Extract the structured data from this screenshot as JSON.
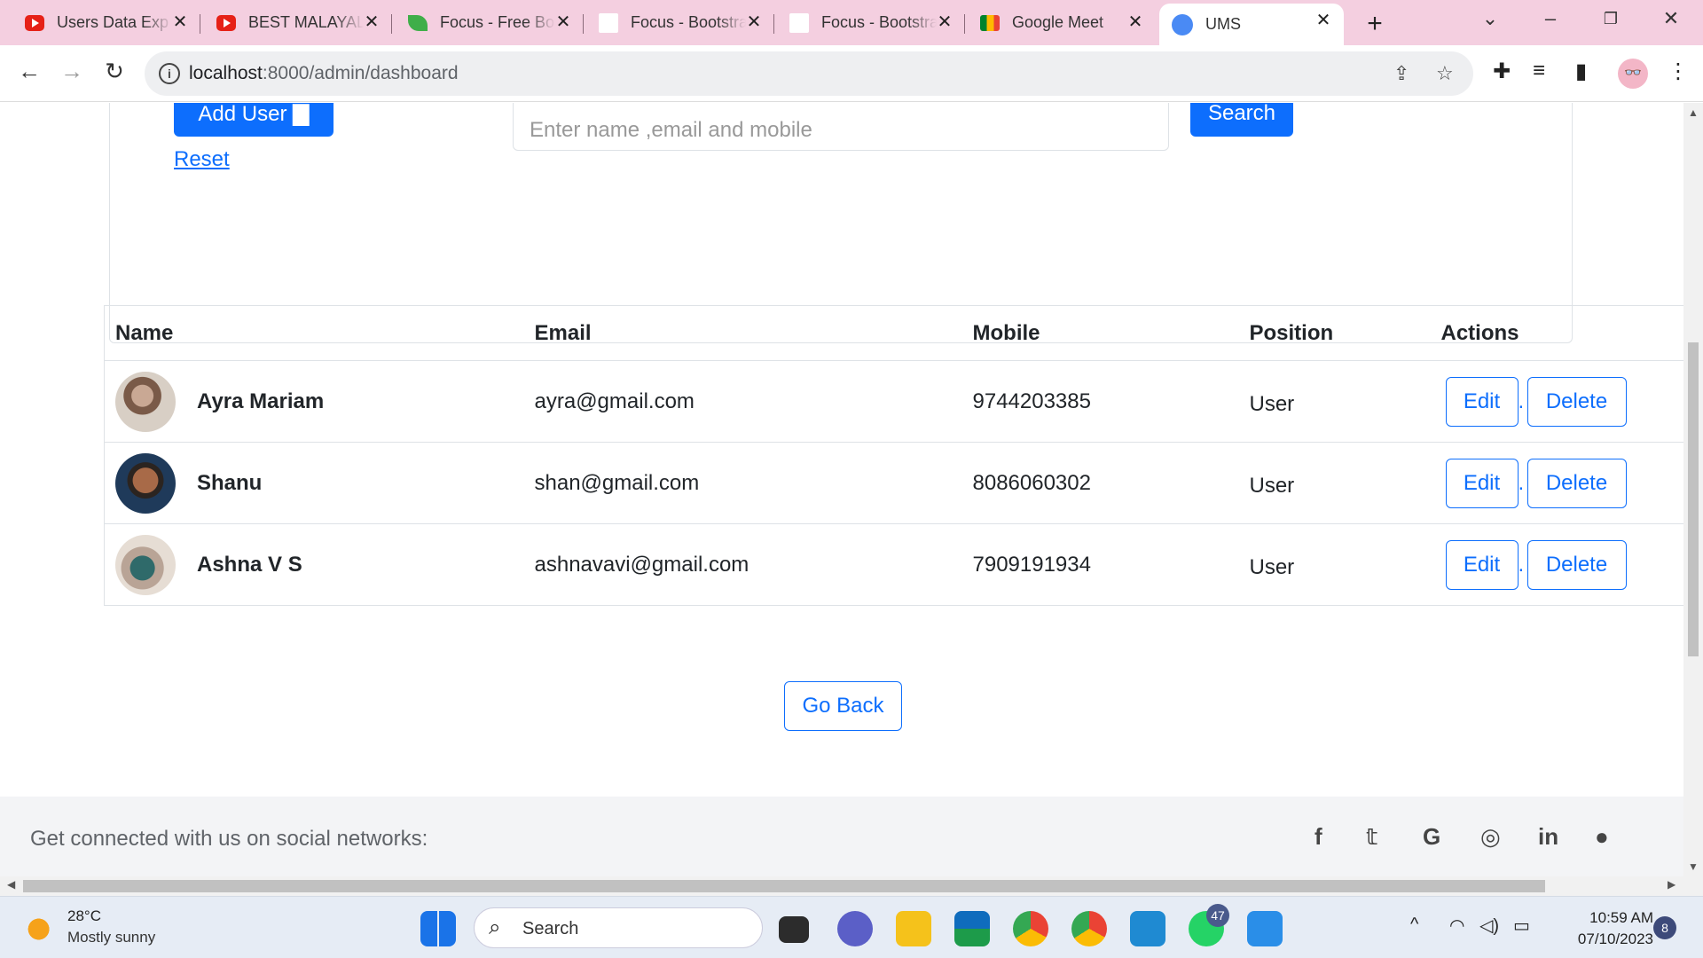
{
  "browser": {
    "tabs": [
      {
        "title": "Users Data Exp",
        "icon": "youtube-icon"
      },
      {
        "title": "BEST MALAYALAM",
        "icon": "youtube-icon"
      },
      {
        "title": "Focus - Free Bootstrap",
        "icon": "leaf-icon"
      },
      {
        "title": "Focus - Bootstrap",
        "icon": "blank-page-icon"
      },
      {
        "title": "Focus - Bootstrap",
        "icon": "blank-page-icon"
      },
      {
        "title": "Google Meet",
        "icon": "google-meet-icon"
      },
      {
        "title": "UMS",
        "icon": "user-icon"
      }
    ],
    "url_host": "localhost",
    "url_path": ":8000/admin/dashboard"
  },
  "page": {
    "add_user_label": "Add User",
    "search_placeholder": "Enter name ,email and mobile",
    "search_label": "Search",
    "reset_label": "Reset",
    "table": {
      "headers": [
        "Name",
        "Email",
        "Mobile",
        "Position",
        "Actions"
      ],
      "rows": [
        {
          "name": "Ayra Mariam",
          "email": "ayra@gmail.com",
          "mobile": "9744203385",
          "position": "User"
        },
        {
          "name": "Shanu",
          "email": "shan@gmail.com",
          "mobile": "8086060302",
          "position": "User"
        },
        {
          "name": "Ashna V S",
          "email": "ashnavavi@gmail.com",
          "mobile": "7909191934",
          "position": "User"
        }
      ],
      "edit_label": "Edit",
      "delete_label": "Delete"
    },
    "go_back_label": "Go Back",
    "footer_text": "Get connected with us on social networks:",
    "social_icons": [
      "facebook-icon",
      "twitter-icon",
      "google-icon",
      "instagram-icon",
      "linkedin-icon",
      "github-icon"
    ]
  },
  "taskbar": {
    "temperature": "28°C",
    "weather": "Mostly sunny",
    "search_label": "Search",
    "time": "10:59 AM",
    "date": "07/10/2023",
    "whatsapp_badge": "47",
    "notification_count": "8"
  },
  "colors": {
    "primary": "#0d6efd",
    "tabstrip": "#f4cfe0",
    "footer": "#f3f4f6"
  }
}
